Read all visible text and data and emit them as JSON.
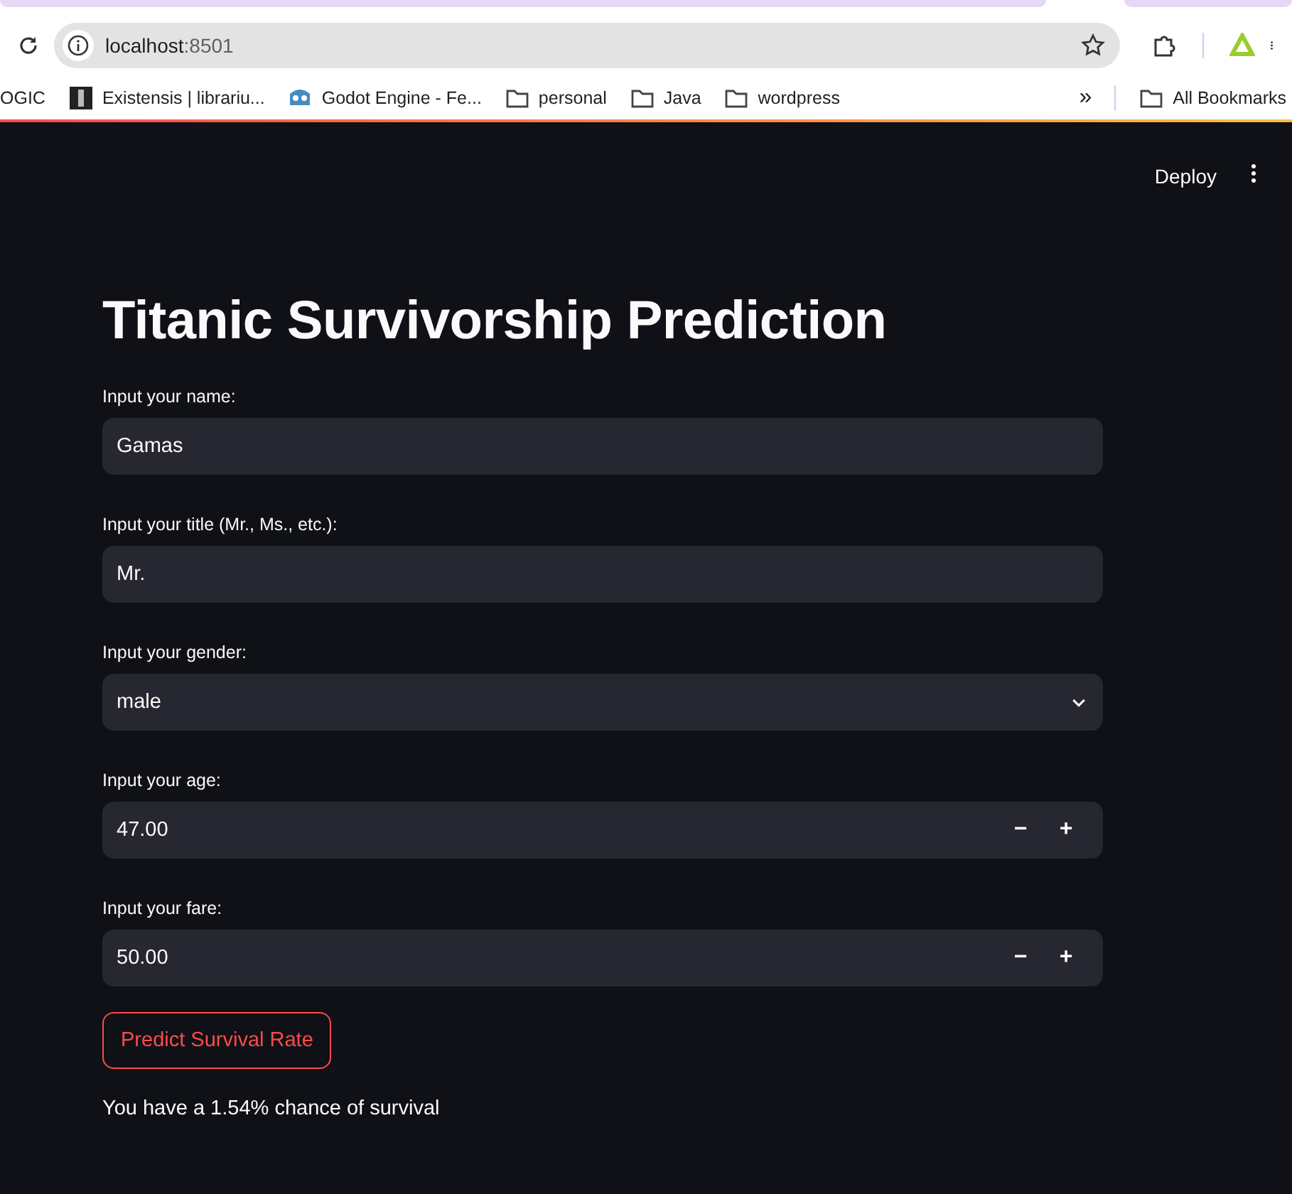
{
  "browser": {
    "url_host": "localhost",
    "url_port": ":8501",
    "bookmarks": [
      {
        "label": "OGIC",
        "kind": "none"
      },
      {
        "label": "Existensis | librariu...",
        "kind": "site"
      },
      {
        "label": "Godot Engine - Fe...",
        "kind": "godot"
      },
      {
        "label": "personal",
        "kind": "folder"
      },
      {
        "label": "Java",
        "kind": "folder"
      },
      {
        "label": "wordpress",
        "kind": "folder"
      }
    ],
    "overflow": "»",
    "all_bookmarks": "All Bookmarks"
  },
  "header": {
    "deploy": "Deploy"
  },
  "title": "Titanic Survivorship Prediction",
  "fields": [
    {
      "kind": "text",
      "label": "Input your name:",
      "value": "Gamas"
    },
    {
      "kind": "text",
      "label": "Input your title (Mr., Ms., etc.):",
      "value": "Mr."
    },
    {
      "kind": "select",
      "label": "Input your gender:",
      "value": "male"
    },
    {
      "kind": "number",
      "label": "Input your age:",
      "value": "47.00",
      "minus": "−",
      "plus": "+"
    },
    {
      "kind": "number",
      "label": "Input your fare:",
      "value": "50.00",
      "minus": "−",
      "plus": "+"
    }
  ],
  "button": "Predict Survival Rate",
  "result": "You have a 1.54% chance of survival"
}
